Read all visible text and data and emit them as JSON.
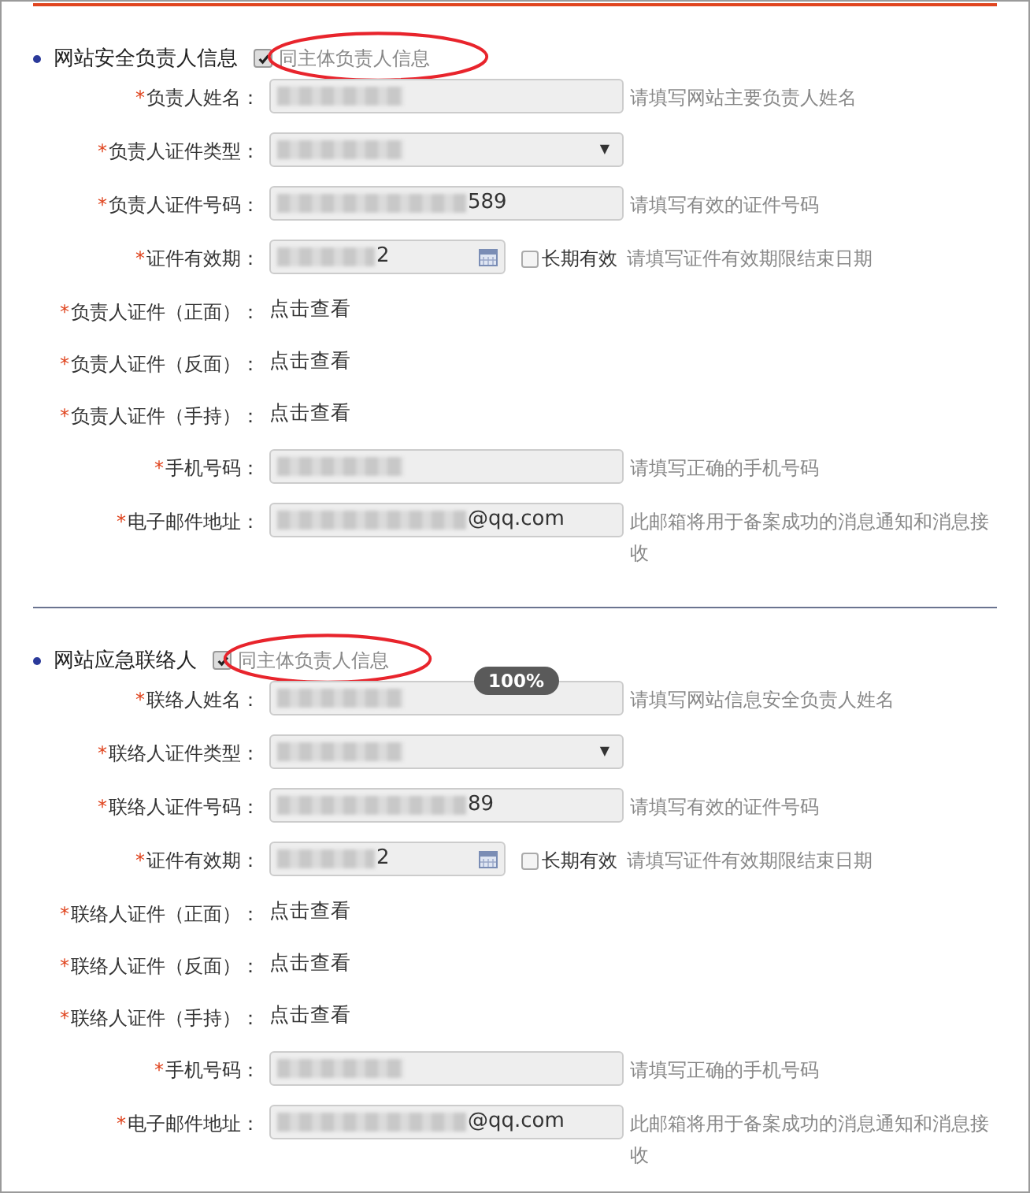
{
  "sections": [
    {
      "title": "网站安全负责人信息",
      "same_as_owner": {
        "label": "同主体负责人信息",
        "checked": true
      },
      "highlighted": true,
      "rows": [
        {
          "kind": "text",
          "label": "负责人姓名：",
          "required": "*",
          "masked": true,
          "hint": "请填写网站主要负责人姓名"
        },
        {
          "kind": "select",
          "label": "负责人证件类型：",
          "required": "*",
          "masked": true,
          "caret": "▼"
        },
        {
          "kind": "text",
          "label": "负责人证件号码：",
          "required": "*",
          "masked": true,
          "value": "589",
          "hint": "请填写有效的证件号码"
        },
        {
          "kind": "date",
          "label": "证件有效期：",
          "required": "*",
          "masked": true,
          "value": "2",
          "long_term": {
            "label": "长期有效",
            "checked": false
          },
          "hint": "请填写证件有效期限结束日期"
        },
        {
          "kind": "link",
          "label": "负责人证件（正面）：",
          "required": "*",
          "link": "点击查看"
        },
        {
          "kind": "link",
          "label": "负责人证件（反面）：",
          "required": "*",
          "link": "点击查看"
        },
        {
          "kind": "link",
          "label": "负责人证件（手持）：",
          "required": "*",
          "link": "点击查看"
        },
        {
          "kind": "text",
          "label": "手机号码：",
          "required": "*",
          "masked": true,
          "hint": "请填写正确的手机号码"
        },
        {
          "kind": "text",
          "label": "电子邮件地址：",
          "required": "*",
          "masked": true,
          "value": "@qq.com",
          "hint": "此邮箱将用于备案成功的消息通知和消息接收"
        }
      ]
    },
    {
      "title": "网站应急联络人",
      "same_as_owner": {
        "label": "同主体负责人信息",
        "checked": true
      },
      "highlighted": true,
      "zoom_badge": "100%",
      "rows": [
        {
          "kind": "text",
          "label": "联络人姓名：",
          "required": "*",
          "masked": true,
          "hint": "请填写网站信息安全负责人姓名"
        },
        {
          "kind": "select",
          "label": "联络人证件类型：",
          "required": "*",
          "masked": true,
          "caret": "▼"
        },
        {
          "kind": "text",
          "label": "联络人证件号码：",
          "required": "*",
          "masked": true,
          "value": "89",
          "hint": "请填写有效的证件号码"
        },
        {
          "kind": "date",
          "label": "证件有效期：",
          "required": "*",
          "masked": true,
          "value": "2",
          "long_term": {
            "label": "长期有效",
            "checked": false
          },
          "hint": "请填写证件有效期限结束日期"
        },
        {
          "kind": "link",
          "label": "联络人证件（正面）：",
          "required": "*",
          "link": "点击查看"
        },
        {
          "kind": "link",
          "label": "联络人证件（反面）：",
          "required": "*",
          "link": "点击查看"
        },
        {
          "kind": "link",
          "label": "联络人证件（手持）：",
          "required": "*",
          "link": "点击查看"
        },
        {
          "kind": "text",
          "label": "手机号码：",
          "required": "*",
          "masked": true,
          "hint": "请填写正确的手机号码"
        },
        {
          "kind": "text",
          "label": "电子邮件地址：",
          "required": "*",
          "masked": true,
          "value": "@qq.com",
          "hint": "此邮箱将用于备案成功的消息通知和消息接收"
        }
      ]
    }
  ]
}
